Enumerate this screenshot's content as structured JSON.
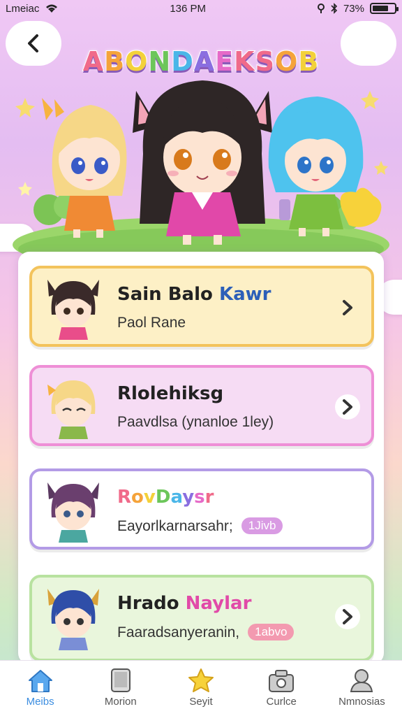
{
  "status": {
    "carrier": "Lmeiac",
    "time": "136 PM",
    "battery": "73%",
    "battery_level": 0.73
  },
  "header": {
    "title": "ABONDAEKSOB"
  },
  "colors": {
    "accent": "#3b8de0",
    "card1": "#f3c35c",
    "card2": "#ee8fd6",
    "card3": "#b39be6",
    "card4": "#b8e2a0"
  },
  "cards": [
    {
      "title": "Sain Balo",
      "title_accent": "Kawr",
      "subtitle": "Paol Rane",
      "badge": ""
    },
    {
      "title": "Rlolehiksg",
      "title_accent": "",
      "subtitle": "Paavdlsa (ynanloe 1ley)",
      "badge": ""
    },
    {
      "title": "RovDaysr",
      "title_accent": "",
      "subtitle": "Eayorlkarnarsahr;",
      "badge": "1Jivb"
    },
    {
      "title": "Hrado",
      "title_accent": "Naylar",
      "subtitle": "Faaradsanyeranin,",
      "badge": "1abvo"
    }
  ],
  "nav": [
    {
      "label": "Meibs",
      "icon": "home-icon"
    },
    {
      "label": "Morion",
      "icon": "tablet-icon"
    },
    {
      "label": "Seyit",
      "icon": "star-icon"
    },
    {
      "label": "Curlce",
      "icon": "camera-icon"
    },
    {
      "label": "Nmnosias",
      "icon": "profile-icon"
    }
  ]
}
